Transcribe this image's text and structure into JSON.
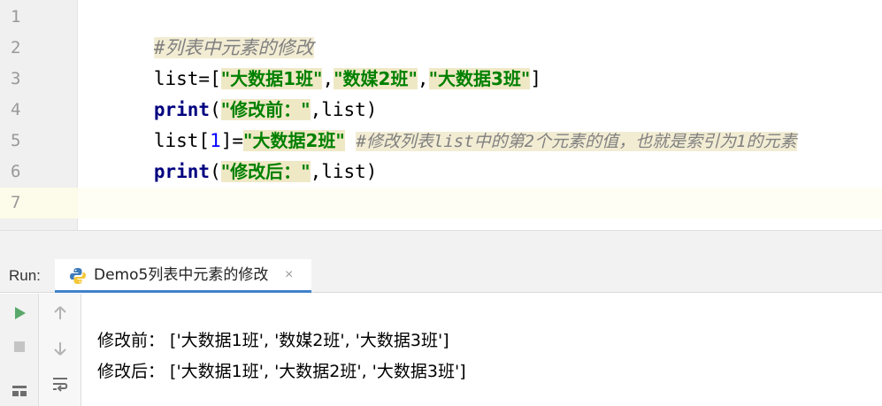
{
  "editor": {
    "line_numbers": [
      "1",
      "2",
      "3",
      "4",
      "5",
      "6",
      "7"
    ],
    "line1": {
      "comment": "#列表中元素的修改"
    },
    "line2": {
      "ident": "list=[",
      "s1": "\"大数据1班\"",
      "comma1": ",",
      "s2": "\"数媒2班\"",
      "comma2": ",",
      "s3": "\"大数据3班\"",
      "close": "]"
    },
    "line3": {
      "kw": "print",
      "open": "(",
      "str": "\"修改前：\"",
      "rest": ",list)"
    },
    "line4": {
      "ident": "list[",
      "num": "1",
      "eq": "]=",
      "str": "\"大数据2班\"",
      "comment": "#修改列表list中的第2个元素的值，也就是索引为1的元素"
    },
    "line5": {
      "kw": "print",
      "open": "(",
      "str": "\"修改后：\"",
      "rest": ",list)"
    }
  },
  "run": {
    "label": "Run:",
    "tab_title": "Demo5列表中元素的修改",
    "close_glyph": "×",
    "icons": [
      "run-icon",
      "stop-icon",
      "layout-icon",
      "scroll-up-icon",
      "scroll-down-icon",
      "soft-wrap-icon",
      "python-icon"
    ]
  },
  "output": {
    "line1": "修改前： ['大数据1班', '数媒2班', '大数据3班']",
    "line2": "修改后： ['大数据1班', '大数据2班', '大数据3班']"
  },
  "colors": {
    "keyword": "#000080",
    "string": "#008000",
    "number": "#0000ff",
    "comment": "#808080",
    "run_green": "#59a869",
    "tab_underline": "#4083c9"
  }
}
